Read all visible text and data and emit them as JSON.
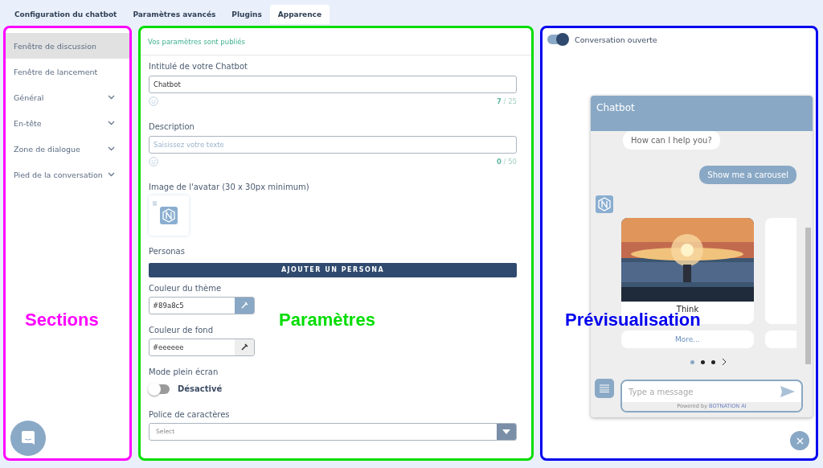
{
  "tabs": [
    {
      "label": "Configuration du chatbot",
      "selected": false
    },
    {
      "label": "Paramètres avancés",
      "selected": false
    },
    {
      "label": "Plugins",
      "selected": false
    },
    {
      "label": "Apparence",
      "selected": true
    }
  ],
  "sections": {
    "annotation": {
      "label": "Sections",
      "color": "#ff00ff"
    },
    "items": [
      {
        "label": "Fenêtre de discussion",
        "selected": true,
        "expandable": false
      },
      {
        "label": "Fenêtre de lancement",
        "selected": false,
        "expandable": false
      },
      {
        "label": "Général",
        "selected": false,
        "expandable": true
      },
      {
        "label": "En-tête",
        "selected": false,
        "expandable": true
      },
      {
        "label": "Zone de dialogue",
        "selected": false,
        "expandable": true
      },
      {
        "label": "Pied de la conversation",
        "selected": false,
        "expandable": true
      }
    ]
  },
  "settings": {
    "annotation": {
      "label": "Paramètres",
      "color": "#00dd00"
    },
    "status": "Vos paramètres sont publiés",
    "fields": [
      {
        "kind": "text",
        "label": "Intitulé de votre Chatbot",
        "value": "Chatbot",
        "count": "7",
        "limit": "/ 25"
      },
      {
        "kind": "text",
        "label": "Description",
        "placeholder": "Saisissez votre texte",
        "count": "0",
        "limit": "/ 50"
      },
      {
        "kind": "avatar",
        "label": "Image de l'avatar (30 x 30px minimum)"
      },
      {
        "kind": "button",
        "label": "Personas",
        "button": "AJOUTER UN PERSONA"
      },
      {
        "kind": "color",
        "label": "Couleur du thème",
        "value": "#89a8c5"
      },
      {
        "kind": "color",
        "label": "Couleur de fond",
        "value": "#eeeeee"
      },
      {
        "kind": "toggle",
        "label": "Mode plein écran",
        "on": false,
        "state": "Désactivé"
      },
      {
        "kind": "select",
        "label": "Police de caractères",
        "placeholder": "Select"
      }
    ]
  },
  "preview": {
    "annotation": {
      "label": "Prévisualisation",
      "color": "#0000ee"
    },
    "toggle": {
      "label": "Conversation ouverte",
      "on": true
    },
    "chat": {
      "title": "Chatbot",
      "messages": [
        {
          "kind": "bot",
          "text": "How can I help you?"
        },
        {
          "kind": "user",
          "text": "Show me a carousel"
        }
      ],
      "cards": [
        {
          "title": "Think",
          "link": "More..."
        }
      ],
      "dots": [
        {
          "selected": true
        },
        {
          "selected": false
        },
        {
          "selected": false
        }
      ],
      "placeholder": "Type a message",
      "powered": "Powered by",
      "brand": "BOTNATION AI"
    }
  }
}
